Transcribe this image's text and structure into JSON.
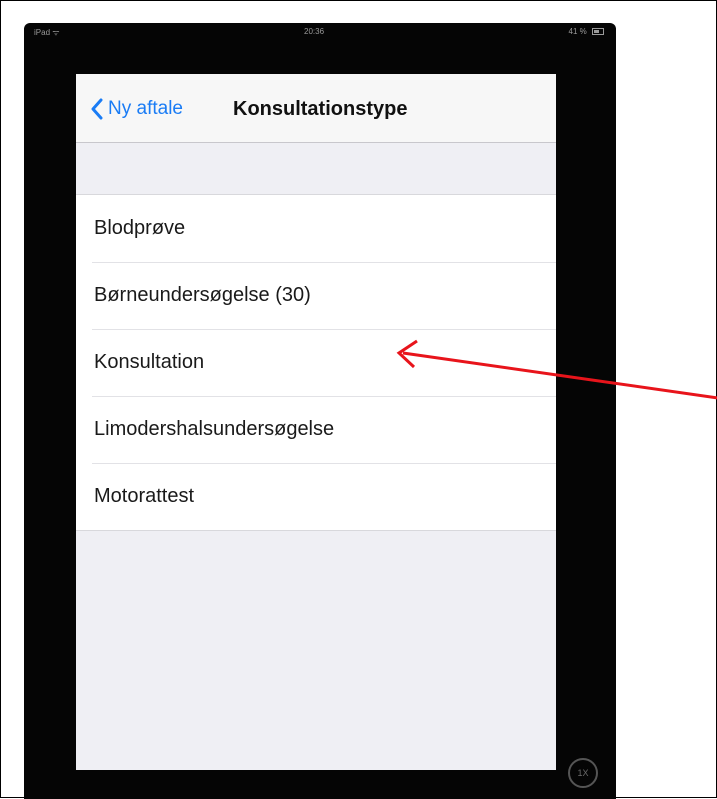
{
  "status_bar": {
    "carrier": "iPad ᯤ",
    "time": "20:36",
    "battery": "41 %"
  },
  "nav": {
    "back_label": "Ny aftale",
    "title": "Konsultationstype"
  },
  "list": {
    "items": [
      {
        "label": "Blodprøve"
      },
      {
        "label": "Børneundersøgelse (30)"
      },
      {
        "label": "Konsultation"
      },
      {
        "label": "Limodershalsundersøgelse"
      },
      {
        "label": "Motorattest"
      }
    ]
  },
  "assistive_touch": {
    "label": "1X"
  },
  "colors": {
    "accent": "#1a7cf5",
    "annotation_arrow": "#e8141b",
    "screen_bg": "#efeff4",
    "device": "#050505"
  },
  "icons": {
    "back": "chevron-left-icon",
    "annotation": "red-arrow-icon"
  }
}
